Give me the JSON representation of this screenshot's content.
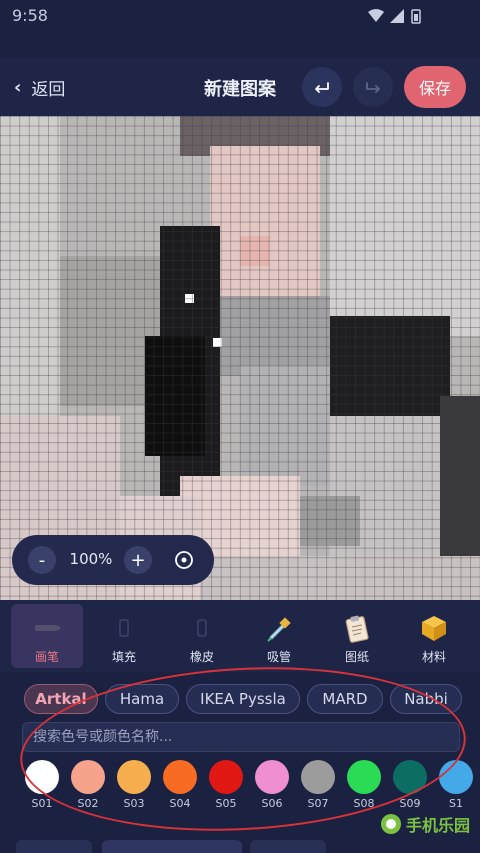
{
  "status_bar": {
    "time": "9:58"
  },
  "header": {
    "back_label": "返回",
    "title": "新建图案",
    "save_label": "保存"
  },
  "zoom": {
    "minus": "-",
    "value": "100%",
    "plus": "+"
  },
  "tools": [
    {
      "label": "画笔",
      "icon": "pencil-icon",
      "active": true
    },
    {
      "label": "填充",
      "icon": "fill-bucket-icon",
      "active": false
    },
    {
      "label": "橡皮",
      "icon": "eraser-icon",
      "active": false
    },
    {
      "label": "吸管",
      "icon": "eyedropper-icon",
      "active": false
    },
    {
      "label": "图纸",
      "icon": "clipboard-icon",
      "active": false
    },
    {
      "label": "材料",
      "icon": "box-icon",
      "active": false
    }
  ],
  "brands": [
    {
      "label": "Artkal",
      "active": true
    },
    {
      "label": "Hama",
      "active": false
    },
    {
      "label": "IKEA Pyssla",
      "active": false
    },
    {
      "label": "MARD",
      "active": false
    },
    {
      "label": "Nabbi",
      "active": false
    }
  ],
  "search": {
    "placeholder": "搜索色号或颜色名称..."
  },
  "swatches": [
    {
      "code": "S01",
      "color": "#ffffff"
    },
    {
      "code": "S02",
      "color": "#f6a38c"
    },
    {
      "code": "S03",
      "color": "#f6ae4f"
    },
    {
      "code": "S04",
      "color": "#f86b23"
    },
    {
      "code": "S05",
      "color": "#e11714"
    },
    {
      "code": "S06",
      "color": "#ef8fd2"
    },
    {
      "code": "S07",
      "color": "#9c9c9c"
    },
    {
      "code": "S08",
      "color": "#2bdb55"
    },
    {
      "code": "S09",
      "color": "#0c6e63"
    },
    {
      "code": "S1",
      "color": "#44a9e8"
    }
  ],
  "watermark": {
    "text": "手机乐园"
  },
  "colors": {
    "accent": "#e06571",
    "background": "#1b2140",
    "panel": "#1e2547"
  }
}
